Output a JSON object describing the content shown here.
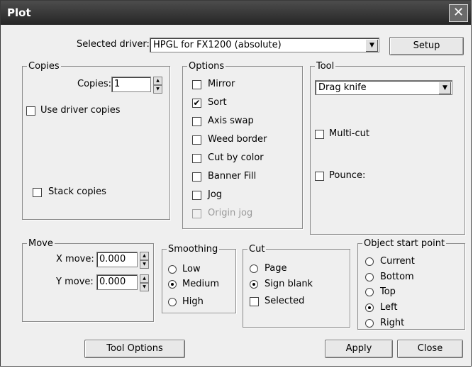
{
  "window": {
    "title": "Plot",
    "close_glyph": "✕"
  },
  "driver": {
    "label": "Selected driver:",
    "value": "HPGL for FX1200 (absolute)",
    "setup_label": "Setup"
  },
  "copies": {
    "legend": "Copies",
    "copies_label": "Copies:",
    "copies_value": "1",
    "use_driver_copies": "Use driver copies",
    "stack_copies": "Stack copies"
  },
  "options": {
    "legend": "Options",
    "items": [
      {
        "label": "Mirror",
        "checked": false
      },
      {
        "label": "Sort",
        "checked": true
      },
      {
        "label": "Axis swap",
        "checked": false
      },
      {
        "label": "Weed border",
        "checked": false
      },
      {
        "label": "Cut by color",
        "checked": false
      },
      {
        "label": "Banner Fill",
        "checked": false
      },
      {
        "label": "Jog",
        "checked": false
      },
      {
        "label": "Origin jog",
        "checked": false,
        "disabled": true
      }
    ]
  },
  "tool": {
    "legend": "Tool",
    "value": "Drag knife",
    "multicut": "Multi-cut",
    "pounce": "Pounce:"
  },
  "move": {
    "legend": "Move",
    "x_label": "X move:",
    "x_value": "0.000",
    "y_label": "Y move:",
    "y_value": "0.000"
  },
  "smoothing": {
    "legend": "Smoothing",
    "options": [
      "Low",
      "Medium",
      "High"
    ],
    "selected": "Medium"
  },
  "cut": {
    "legend": "Cut",
    "page": "Page",
    "sign_blank": "Sign blank",
    "selected_label": "Selected",
    "selected_option": "Sign blank"
  },
  "start_point": {
    "legend": "Object start point",
    "options": [
      "Current",
      "Bottom",
      "Top",
      "Left",
      "Right"
    ],
    "selected": "Left"
  },
  "buttons": {
    "tool_options": "Tool Options",
    "apply": "Apply",
    "close": "Close"
  },
  "icons": {
    "check": "✔",
    "dropdown": "▼",
    "spin_up": "▲",
    "spin_down": "▼"
  }
}
